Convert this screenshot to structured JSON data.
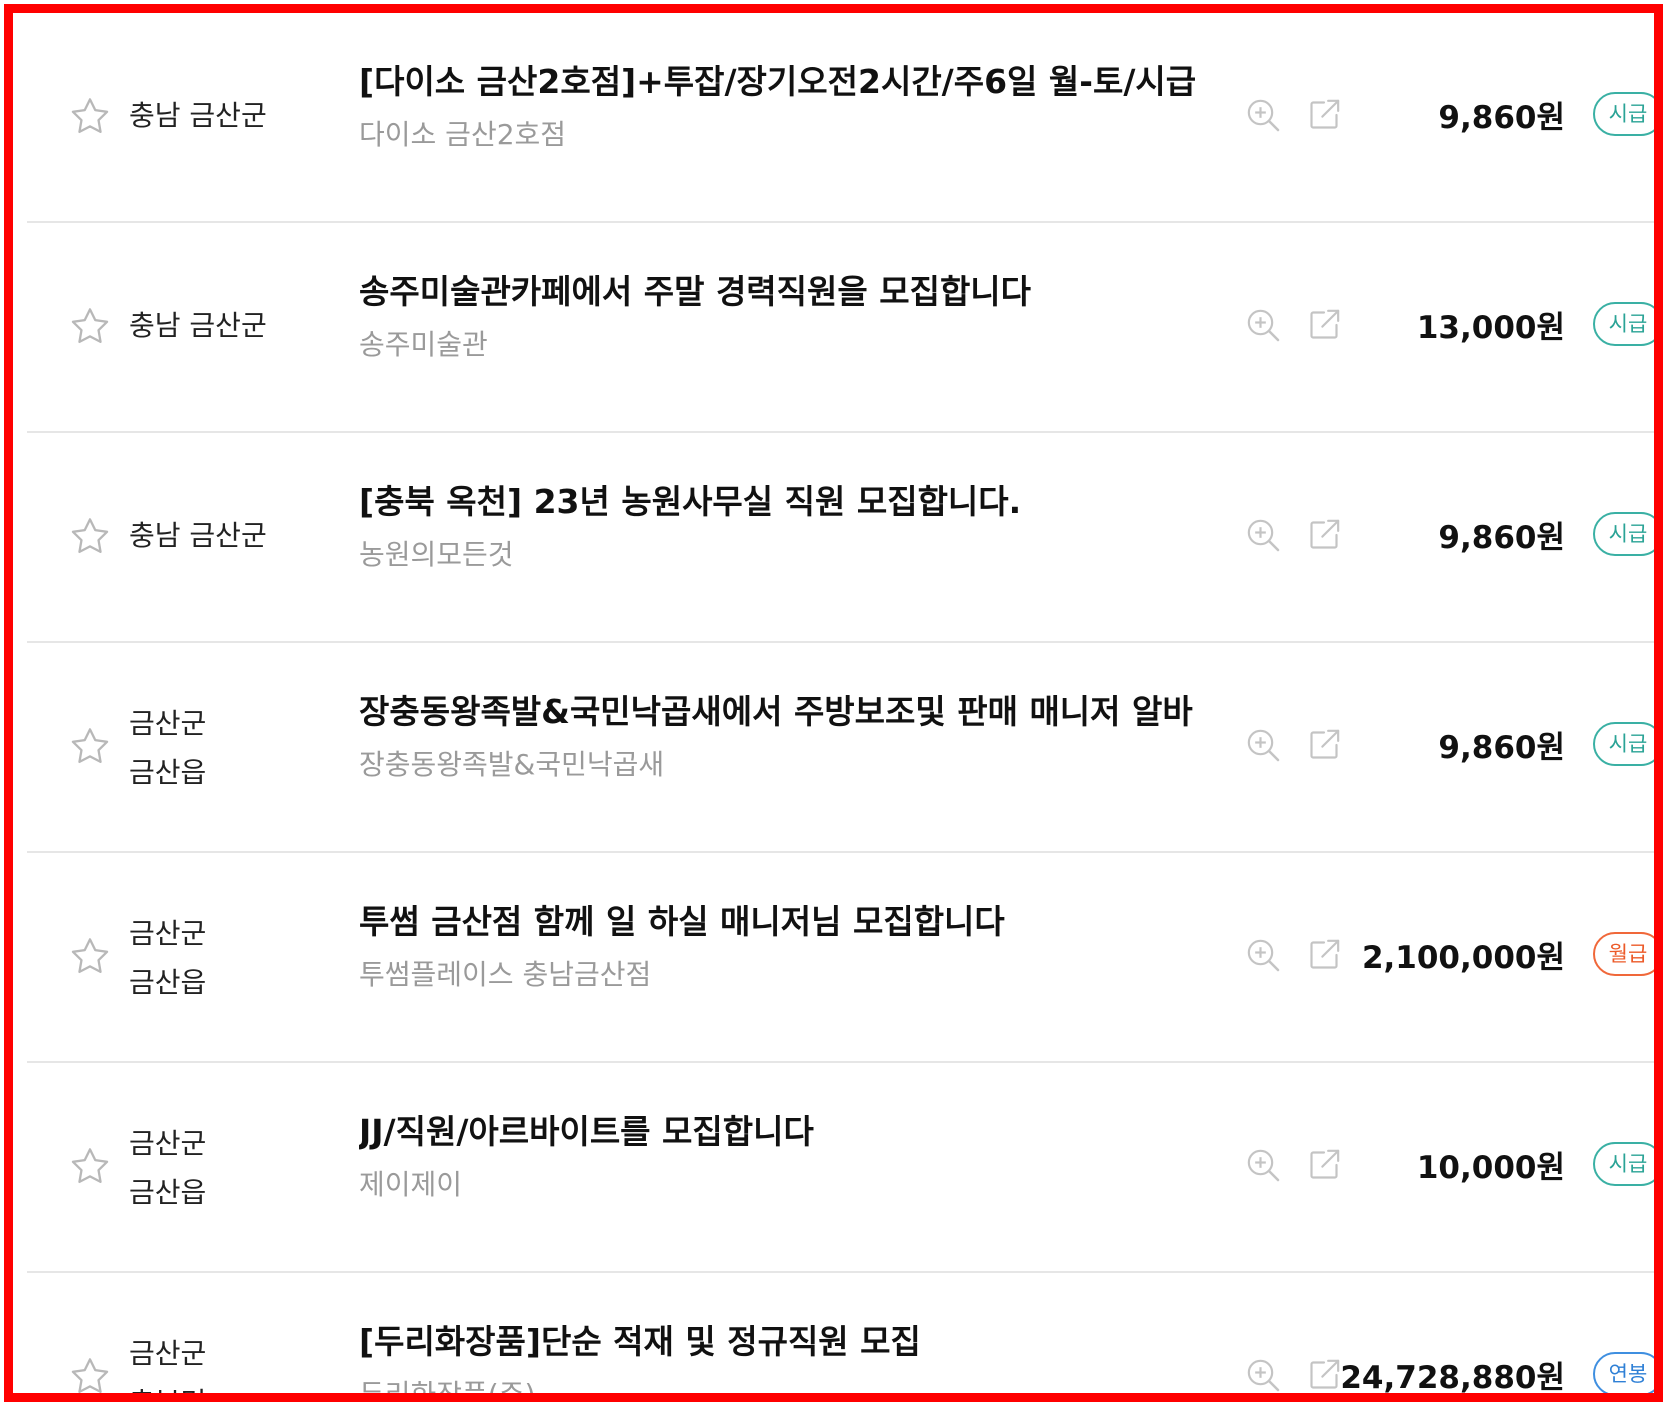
{
  "colors": {
    "frame": "#ff0000",
    "hourly_badge": "#2aa396",
    "monthly_badge": "#ec5a28",
    "annual_badge": "#2f80d6",
    "company_text": "#9a9a9a",
    "divider": "#e6e6e6"
  },
  "icons": {
    "favorite": "star-outline-icon",
    "preview": "zoom-in-icon",
    "open": "external-link-icon"
  },
  "jobs": [
    {
      "region": [
        "충남 금산군"
      ],
      "title": "[다이소 금산2호점]+투잡/장기오전2시간/주6일 월-토/시급",
      "company": "다이소 금산2호점",
      "pay": "9,860원",
      "pay_type": "시급",
      "pay_type_kind": "hourly"
    },
    {
      "region": [
        "충남 금산군"
      ],
      "title": "송주미술관카페에서 주말 경력직원을 모집합니다",
      "company": "송주미술관",
      "pay": "13,000원",
      "pay_type": "시급",
      "pay_type_kind": "hourly"
    },
    {
      "region": [
        "충남 금산군"
      ],
      "title": "[충북 옥천] 23년 농원사무실 직원 모집합니다.",
      "company": "농원의모든것",
      "pay": "9,860원",
      "pay_type": "시급",
      "pay_type_kind": "hourly"
    },
    {
      "region": [
        "금산군",
        "금산읍"
      ],
      "title": "장충동왕족발&국민낙곱새에서 주방보조및 판매 매니저 알바",
      "company": "장충동왕족발&국민낙곱새",
      "pay": "9,860원",
      "pay_type": "시급",
      "pay_type_kind": "hourly"
    },
    {
      "region": [
        "금산군",
        "금산읍"
      ],
      "title": "투썸 금산점 함께 일 하실 매니저님 모집합니다",
      "company": "투썸플레이스 충남금산점",
      "pay": "2,100,000원",
      "pay_type": "월급",
      "pay_type_kind": "monthly"
    },
    {
      "region": [
        "금산군",
        "금산읍"
      ],
      "title": "JJ/직원/아르바이트를 모집합니다",
      "company": "제이제이",
      "pay": "10,000원",
      "pay_type": "시급",
      "pay_type_kind": "hourly"
    },
    {
      "region": [
        "금산군",
        "추부면"
      ],
      "title": "[두리화장품]단순 적재 및 정규직원 모집",
      "company": "두리화장품(주)",
      "pay": "24,728,880원",
      "pay_type": "연봉",
      "pay_type_kind": "annual"
    }
  ]
}
